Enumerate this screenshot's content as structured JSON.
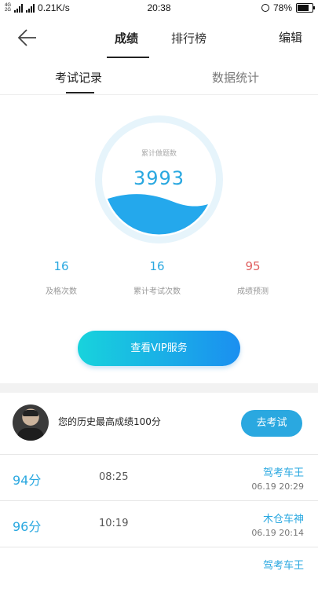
{
  "status_bar": {
    "network_speed": "0.21K/s",
    "time": "20:38",
    "battery": "78%",
    "battery_level": 0.78,
    "net_labels": [
      "4G",
      "2G"
    ]
  },
  "nav": {
    "tabs": [
      {
        "label": "成绩"
      },
      {
        "label": "排行榜"
      }
    ],
    "edit_label": "编辑"
  },
  "sub_tabs": [
    {
      "label": "考试记录"
    },
    {
      "label": "数据统计"
    }
  ],
  "gauge": {
    "label": "累计做题数",
    "value": "3993"
  },
  "stats": [
    {
      "value": "16",
      "caption": "及格次数"
    },
    {
      "value": "16",
      "caption": "累计考试次数"
    },
    {
      "value": "95",
      "caption": "成绩预测"
    }
  ],
  "vip_button": "查看VIP服务",
  "profile": {
    "message": "您的历史最高成绩100分",
    "go_button": "去考试"
  },
  "records": [
    {
      "score": "94分",
      "duration": "08:25",
      "rank": "驾考车王",
      "date": "06.19  20:29"
    },
    {
      "score": "96分",
      "duration": "10:19",
      "rank": "木仓车神",
      "date": "06.19  20:14"
    },
    {
      "score": "",
      "duration": "",
      "rank": "驾考车王",
      "date": ""
    }
  ],
  "colors": {
    "accent": "#2aa8e0",
    "prediction": "#e06060",
    "vip_gradient_start": "#18d3dc",
    "vip_gradient_end": "#1b8ff0"
  }
}
